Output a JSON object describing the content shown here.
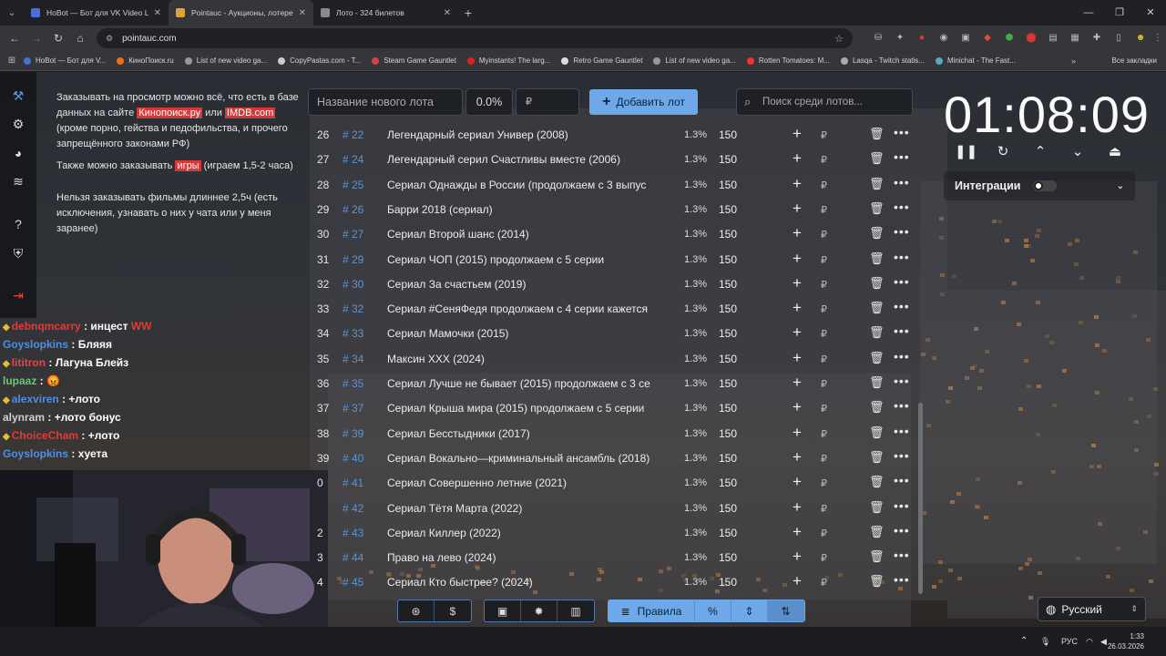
{
  "browser": {
    "tabs": [
      {
        "label": "HoBot — Бот для VK Video Liv",
        "color": "#4a6fd8",
        "active": false
      },
      {
        "label": "Pointauc - Аукционы, лотереи",
        "color": "#e0a33a",
        "active": true
      },
      {
        "label": "Лото - 324 билетов",
        "color": "#8a8a8a",
        "active": false
      }
    ],
    "new_tab": "+",
    "url": "pointauc.com",
    "bookmarks": [
      {
        "label": "HoBot — Бот для V...",
        "color": "#4a6fd8"
      },
      {
        "label": "КиноПоиск.ru",
        "color": "#f26a1b"
      },
      {
        "label": "List of new video ga...",
        "color": "#999999"
      },
      {
        "label": "CopyPastas.com - T...",
        "color": "#cccccc"
      },
      {
        "label": "Steam Game Gauntlet",
        "color": "#c44"
      },
      {
        "label": "Myinstants! The larg...",
        "color": "#d22"
      },
      {
        "label": "Retro Game Gauntlet",
        "color": "#ddd"
      },
      {
        "label": "List of new video ga...",
        "color": "#999999"
      },
      {
        "label": "Rotten Tomatoes: M...",
        "color": "#e33"
      },
      {
        "label": "Lasqa - Twitch statis...",
        "color": "#aaa"
      },
      {
        "label": "Minichat - The Fast...",
        "color": "#5ab"
      }
    ],
    "all_bookmarks": "Все закладки"
  },
  "rules": {
    "p1_pre": "Заказывать на просмотр можно всё, что есть в базе данных на сайте ",
    "p1_link1": "Кинопоиск.ру",
    "p1_mid": " или ",
    "p1_link2": "IMDB.com",
    "p1_post": " (кроме порно, гейства и педофильства, и прочего запрещённого законами РФ)",
    "p2_pre": "Также можно заказывать ",
    "p2_hl": "игры",
    "p2_post": " (играем 1,5-2 часа)",
    "p3": "Нельзя заказывать фильмы длиннее 2,5ч (есть исключения, узнавать о них у чата или у меня заранее)"
  },
  "chat": [
    {
      "user": "debnqmcarry",
      "msg": "инцест",
      "extra": "WW",
      "color": "#e03b3b",
      "badge": true
    },
    {
      "user": "Goyslopkins",
      "msg": "Бляяя",
      "extra": "",
      "color": "#4d8fe6",
      "badge": false
    },
    {
      "user": "lititron",
      "msg": "Лагуна Блейз",
      "extra": "",
      "color": "#d9484f",
      "badge": true
    },
    {
      "user": "lupaaz",
      "msg": "😡",
      "extra": "",
      "color": "#67c77a",
      "badge": false
    },
    {
      "user": "alexviren",
      "msg": "+лото",
      "extra": "",
      "color": "#4d8fe6",
      "badge": true
    },
    {
      "user": "alynram",
      "msg": "+лото бонус",
      "extra": "",
      "color": "#cfcfcf",
      "badge": false
    },
    {
      "user": "ChoiceCham",
      "msg": "+лото",
      "extra": "",
      "color": "#e03b3b",
      "badge": true
    },
    {
      "user": "Goyslopkins",
      "msg": "хуета",
      "extra": "",
      "color": "#4d8fe6",
      "badge": false
    }
  ],
  "controls": {
    "lot_placeholder": "Название нового лота",
    "percent": "0.0%",
    "amount_placeholder": "₽",
    "add_label": "Добавить лот",
    "search_placeholder": "Поиск среди лотов..."
  },
  "lots": [
    {
      "n": "26",
      "id": "# 22",
      "name": "Легендарный сериал Универ (2008)",
      "pct": "1.3%",
      "amount": "150"
    },
    {
      "n": "27",
      "id": "# 24",
      "name": "Легендарный серил Счастливы вместе (2006)",
      "pct": "1.3%",
      "amount": "150"
    },
    {
      "n": "28",
      "id": "# 25",
      "name": "Сериал Однажды в России (продолжаем с 3 выпус",
      "pct": "1.3%",
      "amount": "150"
    },
    {
      "n": "29",
      "id": "# 26",
      "name": "Барри 2018 (сериал)",
      "pct": "1.3%",
      "amount": "150"
    },
    {
      "n": "30",
      "id": "# 27",
      "name": "Сериал Второй шанс (2014)",
      "pct": "1.3%",
      "amount": "150"
    },
    {
      "n": "31",
      "id": "# 29",
      "name": "Сериал ЧОП (2015) продолжаем с 5 серии",
      "pct": "1.3%",
      "amount": "150"
    },
    {
      "n": "32",
      "id": "# 30",
      "name": "Сериал За счастьем (2019)",
      "pct": "1.3%",
      "amount": "150"
    },
    {
      "n": "33",
      "id": "# 32",
      "name": "Сериал #СеняФедя продолжаем с 4 серии кажется",
      "pct": "1.3%",
      "amount": "150"
    },
    {
      "n": "34",
      "id": "# 33",
      "name": "Сериал Мамочки (2015)",
      "pct": "1.3%",
      "amount": "150"
    },
    {
      "n": "35",
      "id": "# 34",
      "name": "Максин XXX (2024)",
      "pct": "1.3%",
      "amount": "150"
    },
    {
      "n": "36",
      "id": "# 35",
      "name": "Сериал Лучше не бывает (2015) продолжаем с 3 се",
      "pct": "1.3%",
      "amount": "150"
    },
    {
      "n": "37",
      "id": "# 37",
      "name": "Сериал Крыша мира (2015) продолжаем с 5 серии",
      "pct": "1.3%",
      "amount": "150"
    },
    {
      "n": "38",
      "id": "# 39",
      "name": "Сериал Бесстыдники (2017)",
      "pct": "1.3%",
      "amount": "150"
    },
    {
      "n": "39",
      "id": "# 40",
      "name": "Сериал Вокально—криминальный ансамбль (2018)",
      "pct": "1.3%",
      "amount": "150"
    },
    {
      "n": "0",
      "id": "# 41",
      "name": "Сериал Совершенно летние (2021)",
      "pct": "1.3%",
      "amount": "150"
    },
    {
      "n": "",
      "id": "# 42",
      "name": "Сериал Тётя Марта (2022)",
      "pct": "1.3%",
      "amount": "150"
    },
    {
      "n": "2",
      "id": "# 43",
      "name": "Сериал Киллер (2022)",
      "pct": "1.3%",
      "amount": "150"
    },
    {
      "n": "3",
      "id": "# 44",
      "name": "Право на лево (2024)",
      "pct": "1.3%",
      "amount": "150"
    },
    {
      "n": "4",
      "id": "# 45",
      "name": "Сериал Кто быстрее? (2024)",
      "pct": "1.3%",
      "amount": "150"
    }
  ],
  "currency": "₽",
  "timer": {
    "value": "01:08:09"
  },
  "integrations": {
    "label": "Интеграции"
  },
  "bottom": {
    "rules_label": "Правила",
    "percent_icon": "%"
  },
  "language": {
    "label": "Русский"
  },
  "taskbar": {
    "lang": "РУС",
    "time": "1:33",
    "date": "26.03.2026"
  }
}
